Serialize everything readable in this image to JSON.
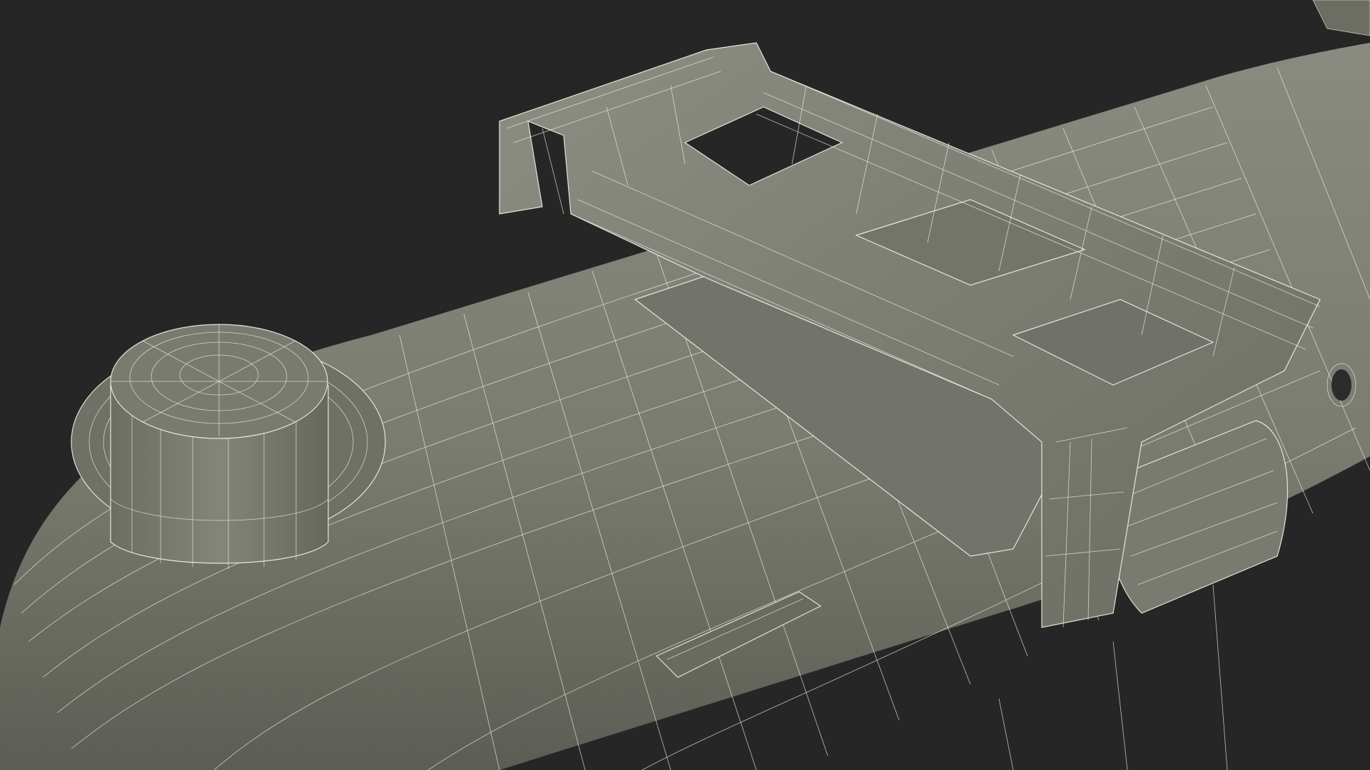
{
  "scene": {
    "background_color": "#262626",
    "surface_color": "#7e7f74",
    "surface_shadow_color": "#5f6057",
    "surface_highlight_color": "#9a9b8f",
    "wire_color": "#f2f2e6"
  }
}
